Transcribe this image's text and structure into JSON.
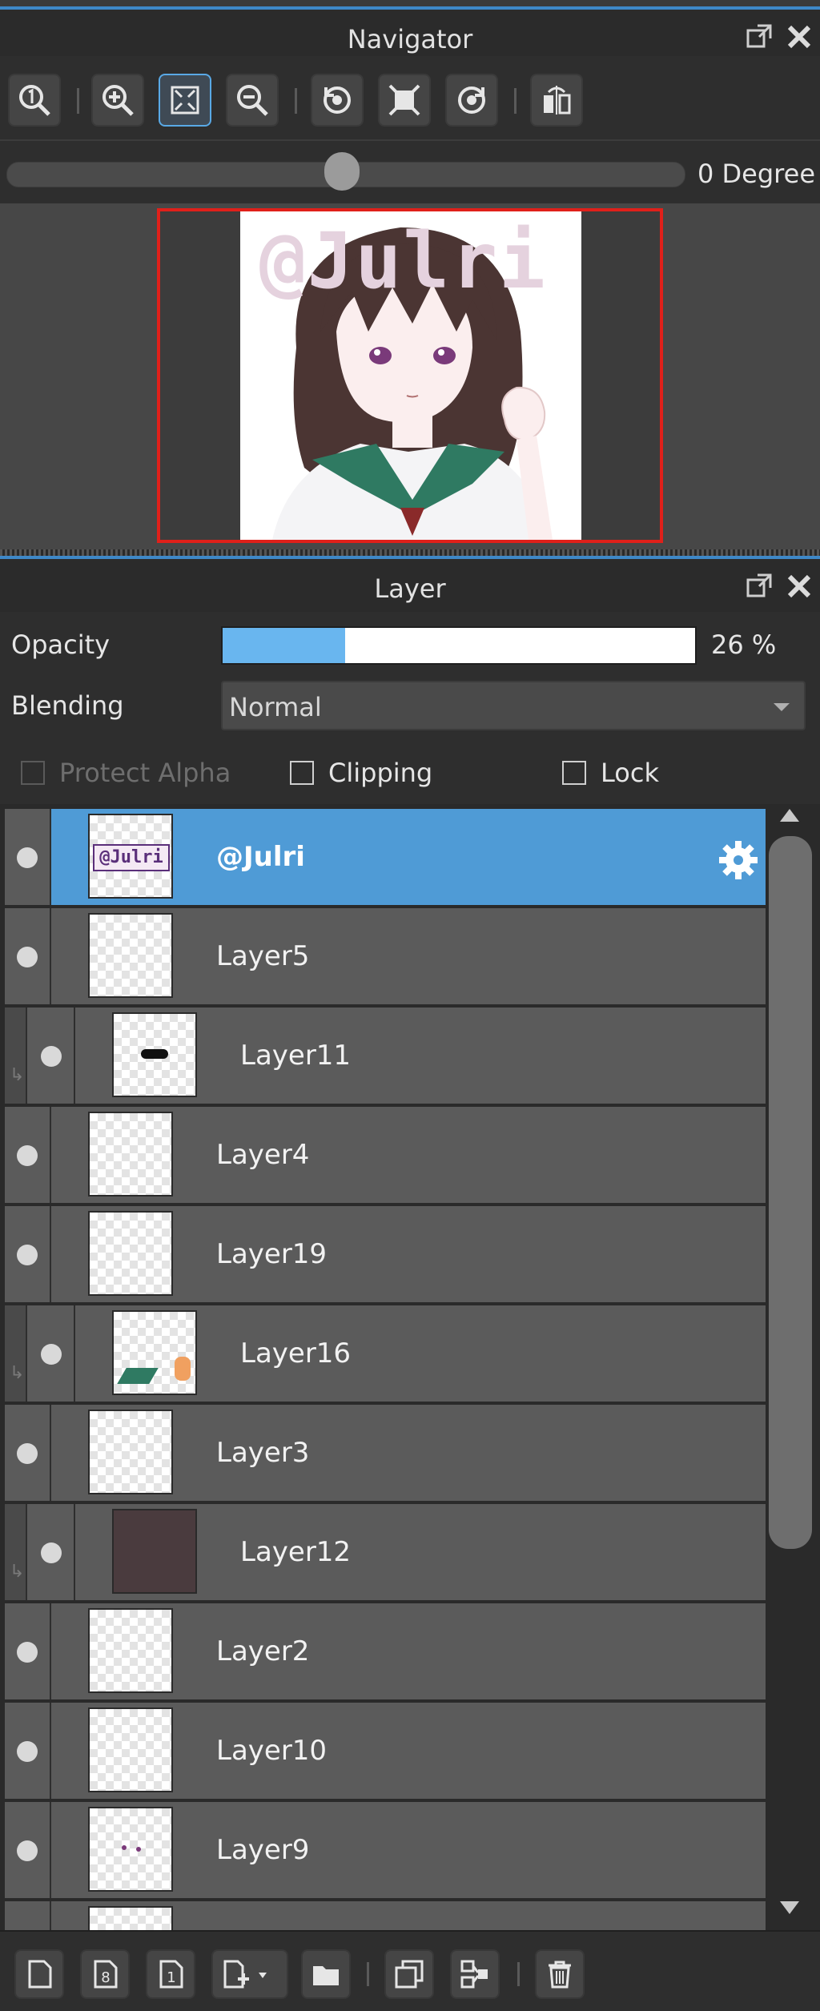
{
  "navigator": {
    "title": "Navigator",
    "rotation_label": "0 Degree",
    "rotation_value": 0,
    "toolbar_icons": [
      "zoom-actual-size-icon",
      "zoom-in-icon",
      "fit-to-window-icon",
      "zoom-out-icon",
      "rotate-left-icon",
      "fit-screen-icon",
      "rotate-right-icon",
      "flip-horizontal-icon"
    ],
    "canvas_watermark": "@Julri"
  },
  "layer_panel": {
    "title": "Layer",
    "opacity_label": "Opacity",
    "opacity_value": "26 %",
    "opacity_fraction": 0.26,
    "blending_label": "Blending",
    "blending_value": "Normal",
    "protect_alpha_label": "Protect Alpha",
    "clipping_label": "Clipping",
    "lock_label": "Lock",
    "selected_thumb_text": "@Julri",
    "layers": [
      {
        "name": "@Julri",
        "selected": true,
        "clipped": false
      },
      {
        "name": "Layer5",
        "selected": false,
        "clipped": false
      },
      {
        "name": "Layer11",
        "selected": false,
        "clipped": true
      },
      {
        "name": "Layer4",
        "selected": false,
        "clipped": false
      },
      {
        "name": "Layer19",
        "selected": false,
        "clipped": false
      },
      {
        "name": "Layer16",
        "selected": false,
        "clipped": true
      },
      {
        "name": "Layer3",
        "selected": false,
        "clipped": false
      },
      {
        "name": "Layer12",
        "selected": false,
        "clipped": true
      },
      {
        "name": "Layer2",
        "selected": false,
        "clipped": false
      },
      {
        "name": "Layer10",
        "selected": false,
        "clipped": false
      },
      {
        "name": "Layer9",
        "selected": false,
        "clipped": false
      }
    ],
    "bottom_toolbar_icons": [
      "new-layer-icon",
      "new-8bit-layer-icon",
      "new-1bit-layer-icon",
      "add-layer-menu-icon",
      "new-folder-icon",
      "duplicate-layer-icon",
      "merge-down-icon",
      "delete-layer-icon"
    ]
  },
  "colors": {
    "accent": "#4f9bd6",
    "preview_border": "#e0201a",
    "opacity_fill": "#69b6ef",
    "layer12_fill": "#4a3b3e"
  }
}
